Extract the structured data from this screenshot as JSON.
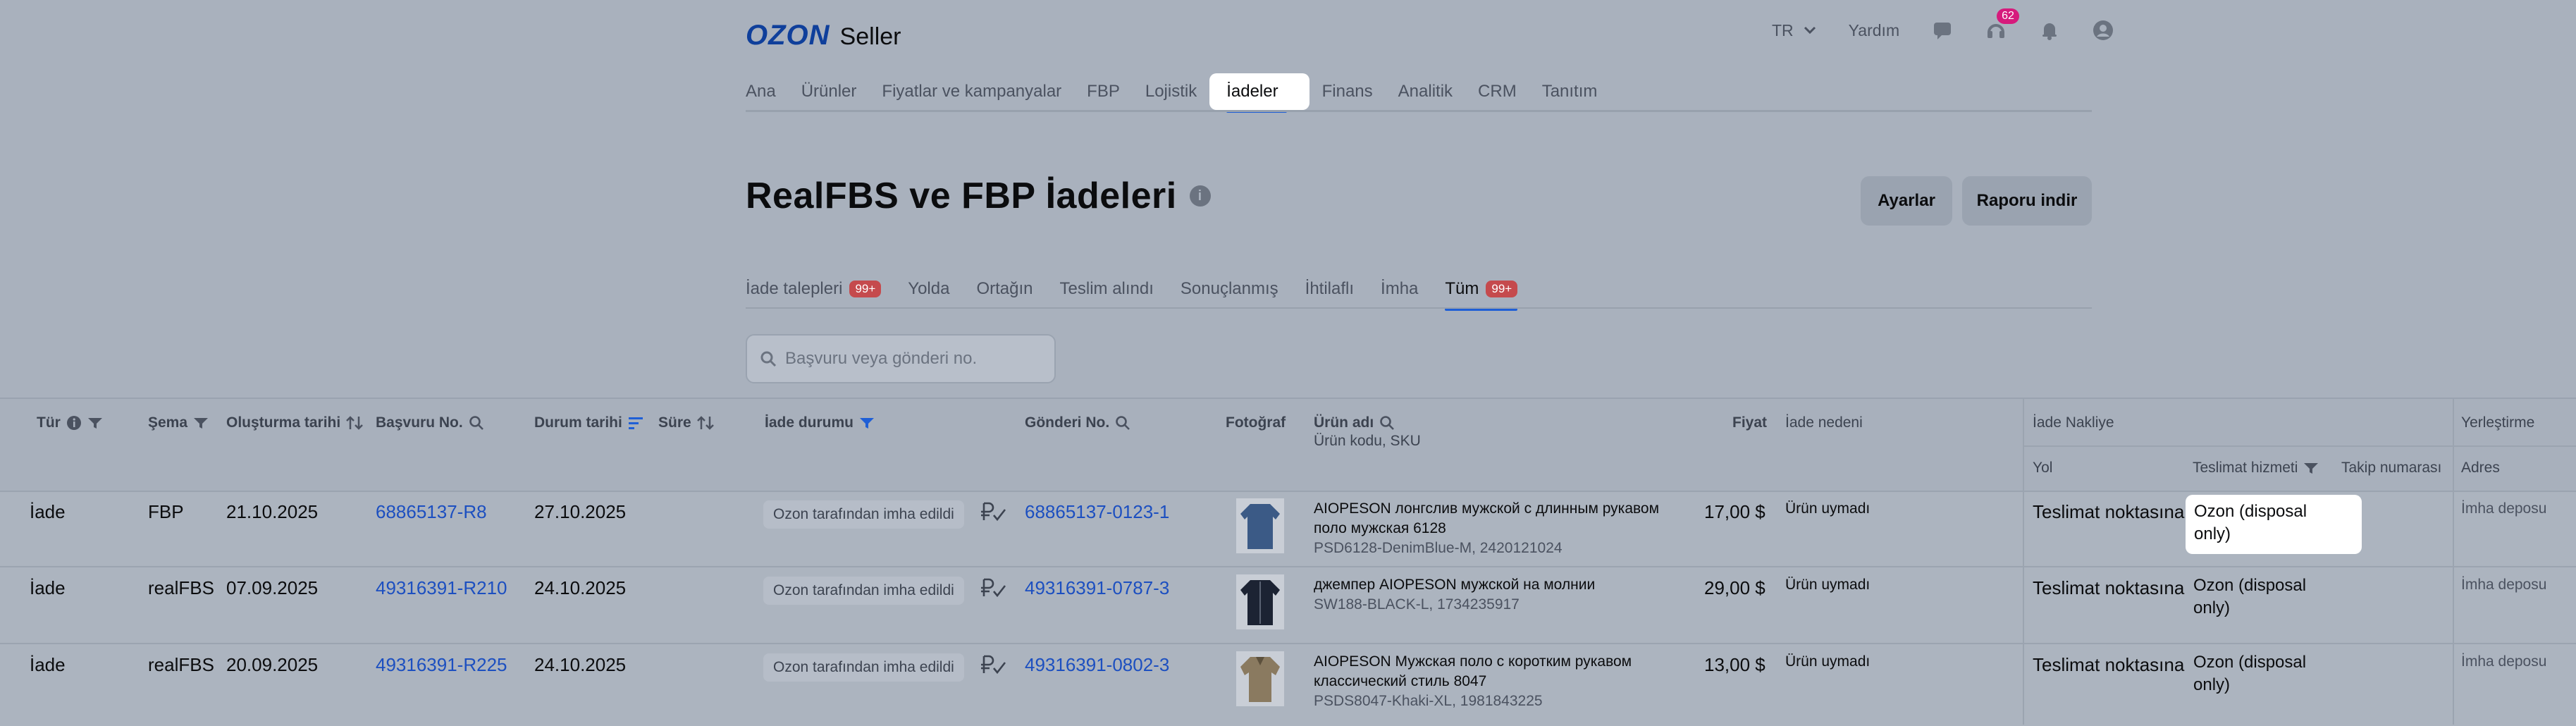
{
  "brand": {
    "logo_main": "OZON",
    "logo_sub": "Seller"
  },
  "topbar": {
    "language": "TR",
    "help": "Yardım",
    "notif_count": "62"
  },
  "nav": {
    "items": [
      "Ana",
      "Ürünler",
      "Fiyatlar ve kampanyalar",
      "FBP",
      "Lojistik",
      "İadeler",
      "Finans",
      "Analitik",
      "CRM",
      "Tanıtım"
    ],
    "active": "İadeler"
  },
  "page": {
    "title": "RealFBS ve FBP İadeleri",
    "settings_button": "Ayarlar",
    "download_button": "Raporu indir"
  },
  "subtabs": [
    {
      "label": "İade talepleri",
      "badge": "99+"
    },
    {
      "label": "Yolda"
    },
    {
      "label": "Ortağın"
    },
    {
      "label": "Teslim alındı"
    },
    {
      "label": "Sonuçlanmış"
    },
    {
      "label": "İhtilaflı"
    },
    {
      "label": "İmha"
    },
    {
      "label": "Tüm",
      "badge": "99+",
      "active": true
    }
  ],
  "search": {
    "placeholder": "Başvuru veya gönderi no."
  },
  "table": {
    "headers": {
      "tur": "Tür",
      "sema": "Şema",
      "olusturma": "Oluşturma tarihi",
      "basvuru": "Başvuru No.",
      "durum_tarihi": "Durum tarihi",
      "sure": "Süre",
      "iade_durumu": "İade durumu",
      "gonderi": "Gönderi No.",
      "fotograf": "Fotoğraf",
      "urun_adi": "Ürün adı",
      "urun_kodu": "Ürün kodu, SKU",
      "fiyat": "Fiyat",
      "iade_nedeni": "İade nedeni",
      "iade_nakliye": "İade Nakliye",
      "yol": "Yol",
      "teslimat_hizmeti": "Teslimat hizmeti",
      "takip": "Takip numarası",
      "yerlestirme": "Yerleştirme",
      "adres": "Adres"
    },
    "rows": [
      {
        "tur": "İade",
        "sema": "FBP",
        "olusturma": "21.10.2025",
        "basvuru": "68865137-R8",
        "durum_tarihi": "27.10.2025",
        "iade_durumu": "Ozon tarafından imha edildi",
        "gonderi": "68865137-0123-1",
        "urun_adi_1": "AIOPESON лонгслив мужской с длинным рукавом",
        "urun_adi_2": "поло мужская 6128",
        "sku": "PSD6128-DenimBlue-M, 2420121024",
        "fiyat": "17,00 $",
        "iade_nedeni": "Ürün uymadı",
        "yol": "Teslimat noktasına",
        "hizmet_1": "Ozon (disposal",
        "hizmet_2": "only)",
        "adres": "İmha deposu",
        "photo_color": "#3b5a86"
      },
      {
        "tur": "İade",
        "sema": "realFBS",
        "olusturma": "07.09.2025",
        "basvuru": "49316391-R210",
        "durum_tarihi": "24.10.2025",
        "iade_durumu": "Ozon tarafından imha edildi",
        "gonderi": "49316391-0787-3",
        "urun_adi_1": "джемпер AIOPESON мужской на молнии",
        "urun_adi_2": "",
        "sku": "SW188-BLACK-L, 1734235917",
        "fiyat": "29,00 $",
        "iade_nedeni": "Ürün uymadı",
        "yol": "Teslimat noktasına",
        "hizmet_1": "Ozon (disposal",
        "hizmet_2": "only)",
        "adres": "İmha deposu",
        "photo_color": "#1c2333"
      },
      {
        "tur": "İade",
        "sema": "realFBS",
        "olusturma": "20.09.2025",
        "basvuru": "49316391-R225",
        "durum_tarihi": "24.10.2025",
        "iade_durumu": "Ozon tarafından imha edildi",
        "gonderi": "49316391-0802-3",
        "urun_adi_1": "AIOPESON Мужская поло с коротким рукавом",
        "urun_adi_2": "классический стиль 8047",
        "sku": "PSDS8047-Khaki-XL, 1981843225",
        "fiyat": "13,00 $",
        "iade_nedeni": "Ürün uymadı",
        "yol": "Teslimat noktasına",
        "hizmet_1": "Ozon (disposal",
        "hizmet_2": "only)",
        "adres": "İmha deposu",
        "photo_color": "#8a7a60"
      }
    ]
  },
  "colors": {
    "accent": "#1f5fd6",
    "link": "#1c4fc0",
    "badge": "#c54a4d",
    "overlay": "#a9b1bd"
  }
}
